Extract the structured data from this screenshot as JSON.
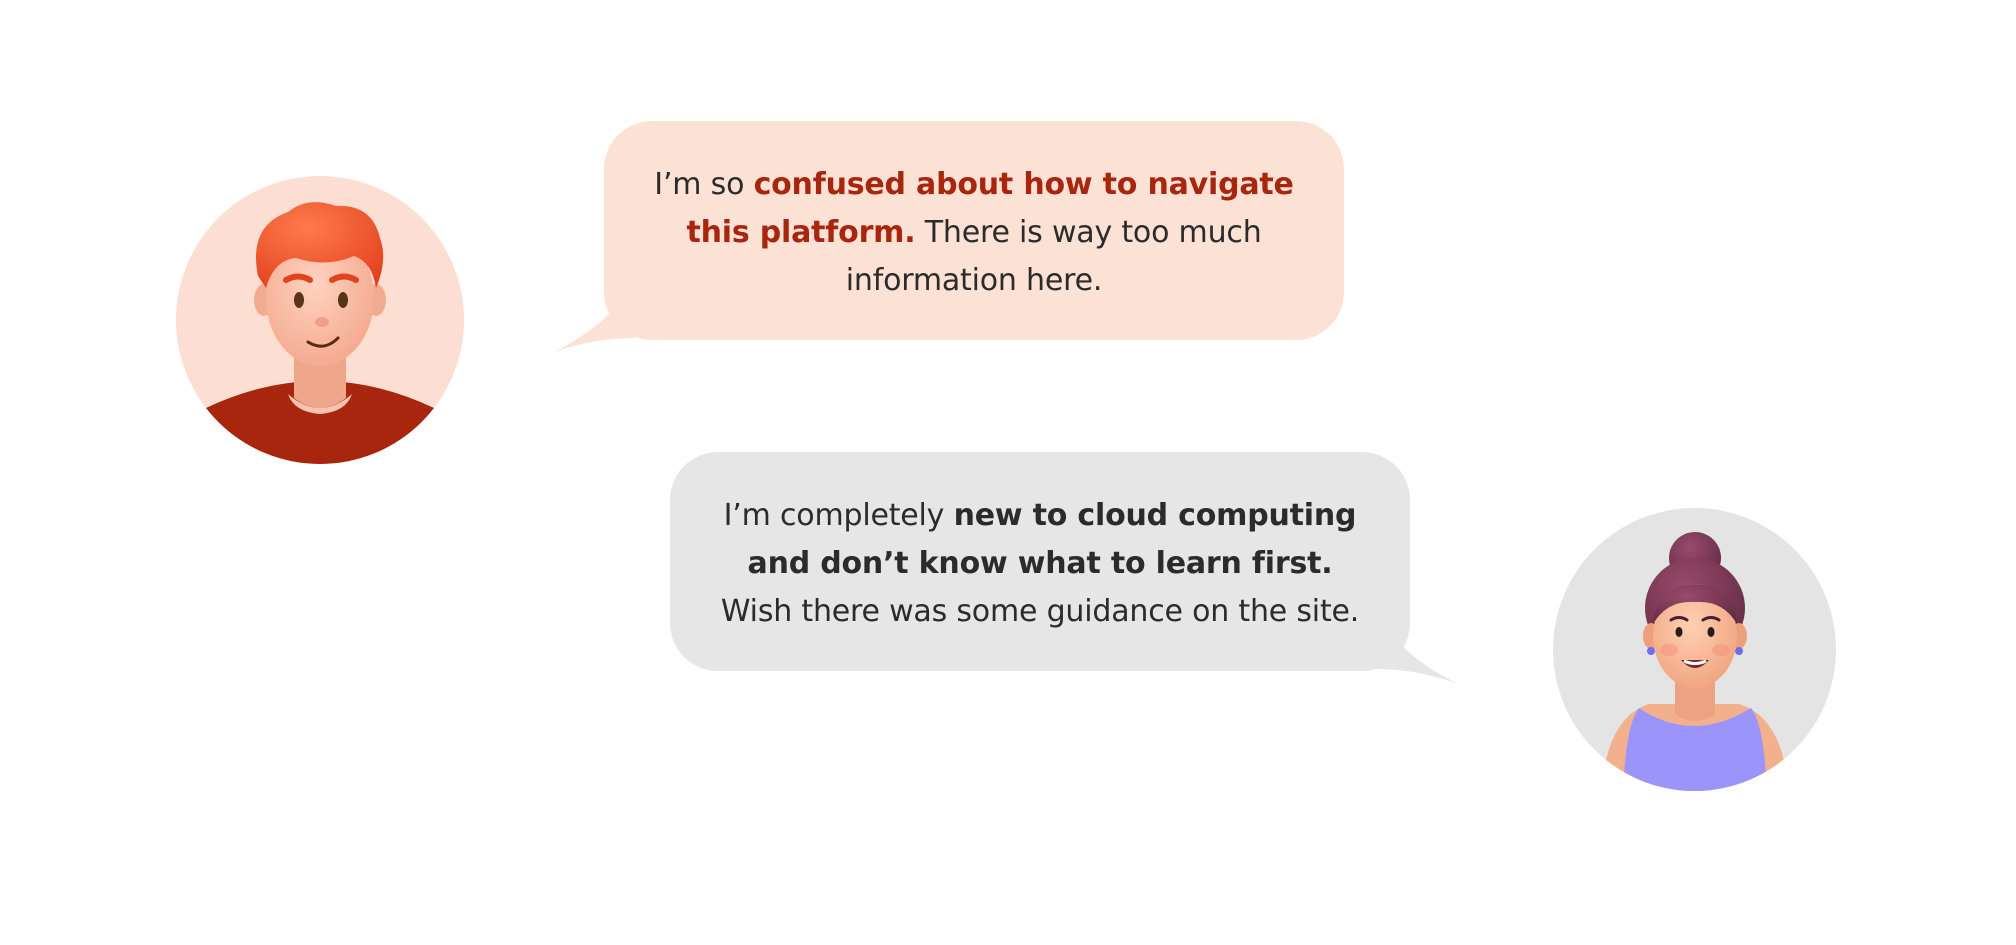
{
  "messages": [
    {
      "speaker": "red-haired-man",
      "parts": {
        "pre": "I’m so ",
        "highlight": "confused about how to navigate this platform.",
        "post": " There is way too much information here."
      },
      "colors": {
        "bubble": "#fce1d5",
        "highlight": "#a8250e",
        "text": "#2b2b2b"
      }
    },
    {
      "speaker": "woman-with-bun",
      "parts": {
        "pre": "I’m completely ",
        "highlight": "new to cloud computing and don’t know what to learn first.",
        "post": " Wish there was some guidance on the site."
      },
      "colors": {
        "bubble": "#e6e6e6",
        "highlight": "#2b2b2b",
        "text": "#2b2b2b"
      }
    }
  ],
  "avatars": {
    "man": {
      "icon": "red-haired-man-avatar-icon",
      "background": "#fcdfd2",
      "shirt": "#a8250e",
      "hair": "#f2542d"
    },
    "woman": {
      "icon": "woman-with-bun-avatar-icon",
      "background": "#e4e4e4",
      "top": "#9b95fb",
      "hair": "#7a3a55"
    }
  }
}
